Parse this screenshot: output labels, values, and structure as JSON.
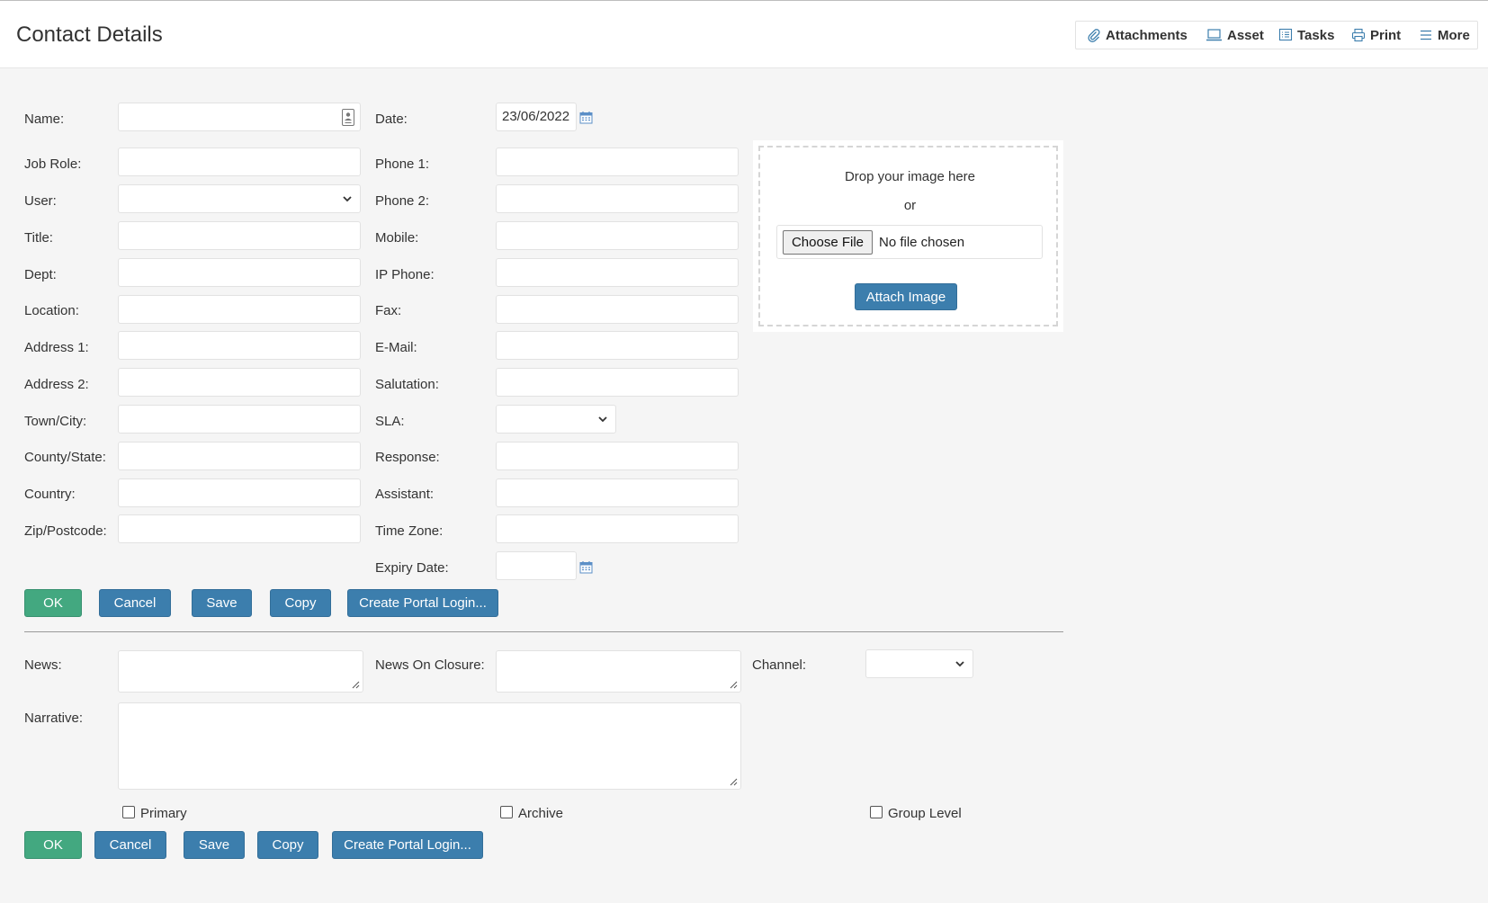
{
  "header": {
    "title": "Contact Details",
    "toolbar": {
      "attachments": "Attachments",
      "asset": "Asset",
      "tasks": "Tasks",
      "print": "Print",
      "more": "More"
    }
  },
  "form": {
    "left": {
      "name": "Name:",
      "job_role": "Job Role:",
      "user": "User:",
      "title": "Title:",
      "dept": "Dept:",
      "location": "Location:",
      "address1": "Address 1:",
      "address2": "Address 2:",
      "town_city": "Town/City:",
      "county_state": "County/State:",
      "country": "Country:",
      "zip": "Zip/Postcode:"
    },
    "right": {
      "date": "Date:",
      "date_value": "23/06/2022",
      "phone1": "Phone 1:",
      "phone2": "Phone 2:",
      "mobile": "Mobile:",
      "ip_phone": "IP Phone:",
      "fax": "Fax:",
      "email": "E-Mail:",
      "salutation": "Salutation:",
      "sla": "SLA:",
      "response": "Response:",
      "assistant": "Assistant:",
      "time_zone": "Time Zone:",
      "expiry_date": "Expiry Date:"
    },
    "image_upload": {
      "drop_text": "Drop your image here",
      "or_text": "or",
      "choose_file": "Choose File",
      "no_file": "No file chosen",
      "attach": "Attach Image"
    }
  },
  "buttons": {
    "ok": "OK",
    "cancel": "Cancel",
    "save": "Save",
    "copy": "Copy",
    "portal": "Create Portal Login..."
  },
  "lower": {
    "news": "News:",
    "news_on_closure": "News On Closure:",
    "channel": "Channel:",
    "narrative": "Narrative:",
    "primary": "Primary",
    "archive": "Archive",
    "group_level": "Group Level"
  },
  "colors": {
    "primary_blue": "#3c7ead",
    "ok_green": "#43a880",
    "calendar_icon": "#5b8fc7"
  }
}
